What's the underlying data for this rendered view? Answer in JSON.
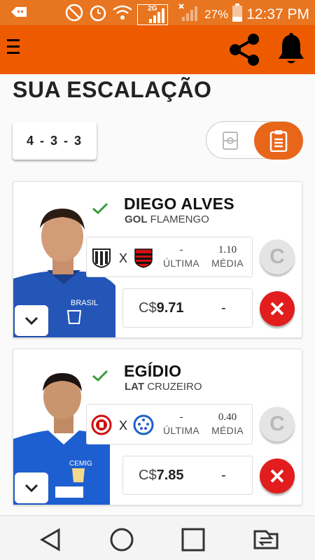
{
  "status_bar": {
    "network_label": "2G",
    "battery": "27%",
    "time": "12:37 PM"
  },
  "page": {
    "title": "SUA ESCALAÇÃO",
    "formation": "4-3-3"
  },
  "players": [
    {
      "name": "DIEGO ALVES",
      "position": "GOL",
      "team": "FLAMENGO",
      "vs": "X",
      "last_value": "-",
      "last_label": "ÚLTIMA",
      "avg_value": "1.10",
      "avg_label": "MÉDIA",
      "captain_label": "C",
      "currency": "C$",
      "price": "9.71",
      "variation": "-",
      "home_badge": "ceara-badge",
      "away_badge": "flamengo-badge"
    },
    {
      "name": "EGÍDIO",
      "position": "LAT",
      "team": "CRUZEIRO",
      "vs": "X",
      "last_value": "-",
      "last_label": "ÚLTIMA",
      "avg_value": "0.40",
      "avg_label": "MÉDIA",
      "captain_label": "C",
      "currency": "C$",
      "price": "7.85",
      "variation": "-",
      "home_badge": "internacional-badge",
      "away_badge": "cruzeiro-badge"
    }
  ],
  "colors": {
    "app_bar": "#ee5a00",
    "status_bar": "#e8751f",
    "toggle_active": "#e8661a",
    "check": "#3a9a3a",
    "remove": "#e11d1d"
  },
  "icons": {
    "menu": "hamburger-menu-icon",
    "share": "share-icon",
    "notifications": "bell-icon",
    "field_view": "soccer-field-icon",
    "list_view": "clipboard-list-icon",
    "expand": "chevron-down-icon",
    "confirmed": "check-icon",
    "remove": "close-icon"
  }
}
